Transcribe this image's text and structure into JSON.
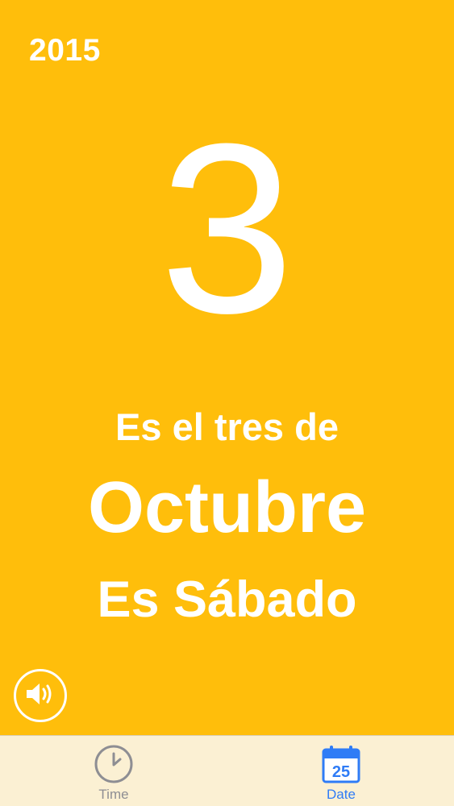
{
  "header": {
    "year": "2015"
  },
  "main": {
    "day_number": "3",
    "line_intro": "Es el tres de",
    "month": "Octubre",
    "weekday_line": "Es Sábado"
  },
  "controls": {
    "speaker_icon": "speaker-icon"
  },
  "tabbar": {
    "tabs": [
      {
        "label": "Time",
        "icon": "clock-icon",
        "selected": false
      },
      {
        "label": "Date",
        "icon": "calendar-icon",
        "selected": true,
        "icon_text": "25"
      }
    ]
  },
  "colors": {
    "background": "#FFBE0B",
    "text": "#FFFFFF",
    "tabbar_background": "#FBF0D3",
    "tab_inactive": "#8E8E93",
    "tab_active": "#2F7CF6"
  }
}
